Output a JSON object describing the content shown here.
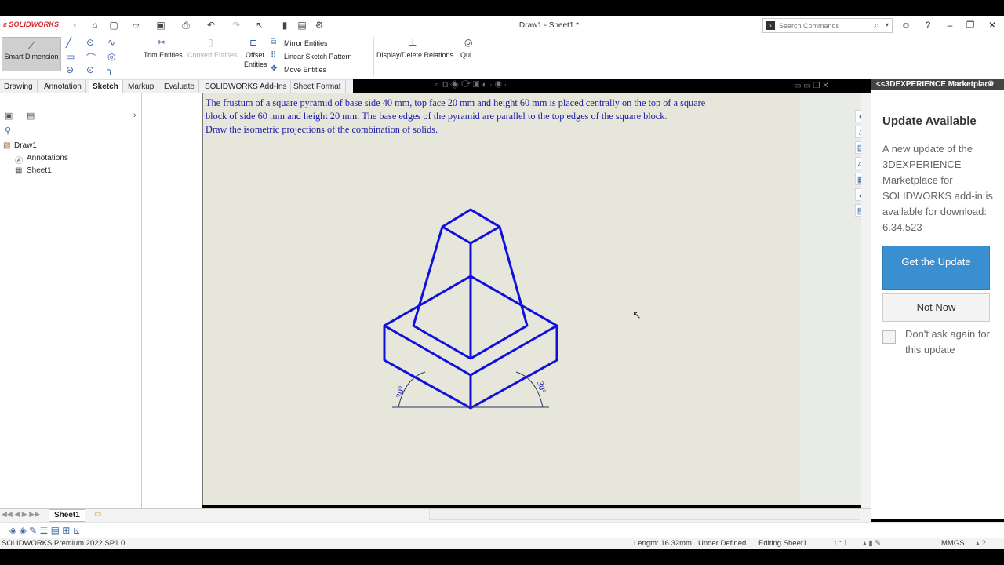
{
  "app": {
    "name": "SOLIDWORKS",
    "doc_title": "Draw1 - Sheet1 *"
  },
  "search": {
    "placeholder": "Search Commands"
  },
  "ribbon": {
    "smart_dimension": "Smart Dimension",
    "trim_entities": "Trim Entities",
    "convert_entities": "Convert Entities",
    "offset_entities_1": "Offset",
    "offset_entities_2": "Entities",
    "mirror_entities": "Mirror Entities",
    "linear_sketch_pattern": "Linear Sketch Pattern",
    "move_entities": "Move Entities",
    "display_delete_relations": "Display/Delete Relations",
    "quick_snaps": "Qui..."
  },
  "tabs": [
    "Drawing",
    "Annotation",
    "Sketch",
    "Markup",
    "Evaluate",
    "SOLIDWORKS Add-Ins",
    "Sheet Format"
  ],
  "active_tab": "Sketch",
  "tree": {
    "root": "Draw1",
    "items": [
      "Annotations",
      "Sheet1"
    ]
  },
  "problem": {
    "line1": "The frustum of a square pyramid of base side 40 mm, top face 20 mm and height 60 mm is placed centrally on the top of a square",
    "line2": "block of side 60 mm and height 20 mm. The base edges of the pyramid are parallel to the top edges of the square block.",
    "line3": "Draw the isometric projections of the combination of solids."
  },
  "drawing": {
    "angle_left": "30°",
    "angle_right": "30°",
    "line_color": "#1010dd"
  },
  "taskpane": {
    "header": "<<3DEXPERIENCE Marketplace",
    "title": "Update Available",
    "message": "A new update of the 3DEXPERIENCE Marketplace for SOLIDWORKS add-in is available for download: 6.34.523",
    "get_update": "Get the Update",
    "not_now": "Not Now",
    "dont_ask": "Don't ask again for this update"
  },
  "sheet_tab": "Sheet1",
  "status": {
    "product": "SOLIDWORKS Premium 2022 SP1.0",
    "length": "Length: 16.32mm",
    "state": "Under Defined",
    "editing": "Editing Sheet1",
    "scale": "1 : 1",
    "units": "MMGS"
  },
  "colors": {
    "accent": "#3a8fd1",
    "drawing_text": "#1a1aaa",
    "sheet_bg": "#e6e6da"
  }
}
